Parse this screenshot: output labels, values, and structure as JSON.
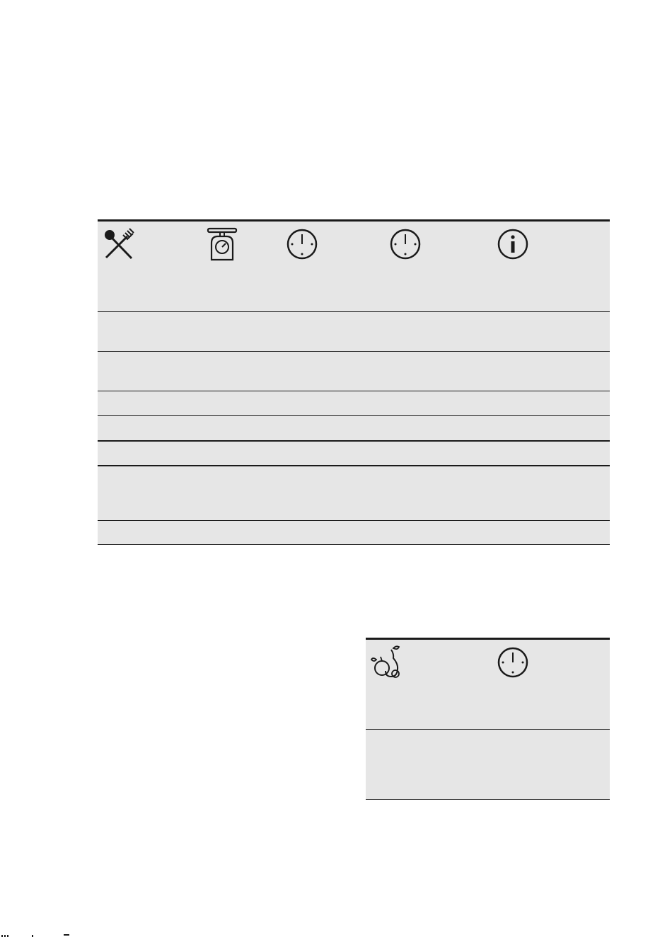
{
  "main_table": {
    "header_icons": [
      "cutlery-icon",
      "kitchen-scale-icon",
      "clock-icon",
      "clock-icon",
      "info-icon"
    ],
    "rows": [
      {
        "cells": [
          "",
          "",
          "",
          "",
          ""
        ]
      },
      {
        "cells": [
          "",
          "",
          "",
          "",
          ""
        ]
      },
      {
        "cells": [
          "",
          "",
          "",
          "",
          ""
        ]
      },
      {
        "cells": [
          "",
          "",
          "",
          "",
          ""
        ]
      },
      {
        "cells": [
          "",
          "",
          "",
          "",
          ""
        ]
      },
      {
        "cells": [
          "",
          "",
          "",
          "",
          ""
        ]
      },
      {
        "cells": [
          "",
          "",
          "",
          "",
          ""
        ]
      }
    ]
  },
  "fruit_table": {
    "header_icons": [
      "fruit-icon",
      "clock-icon"
    ],
    "rows": [
      {
        "cells": [
          "",
          ""
        ]
      }
    ]
  },
  "colors": {
    "table_fill": "#e6e6e6",
    "rule": "#1a1a1a",
    "page": "#ffffff"
  }
}
